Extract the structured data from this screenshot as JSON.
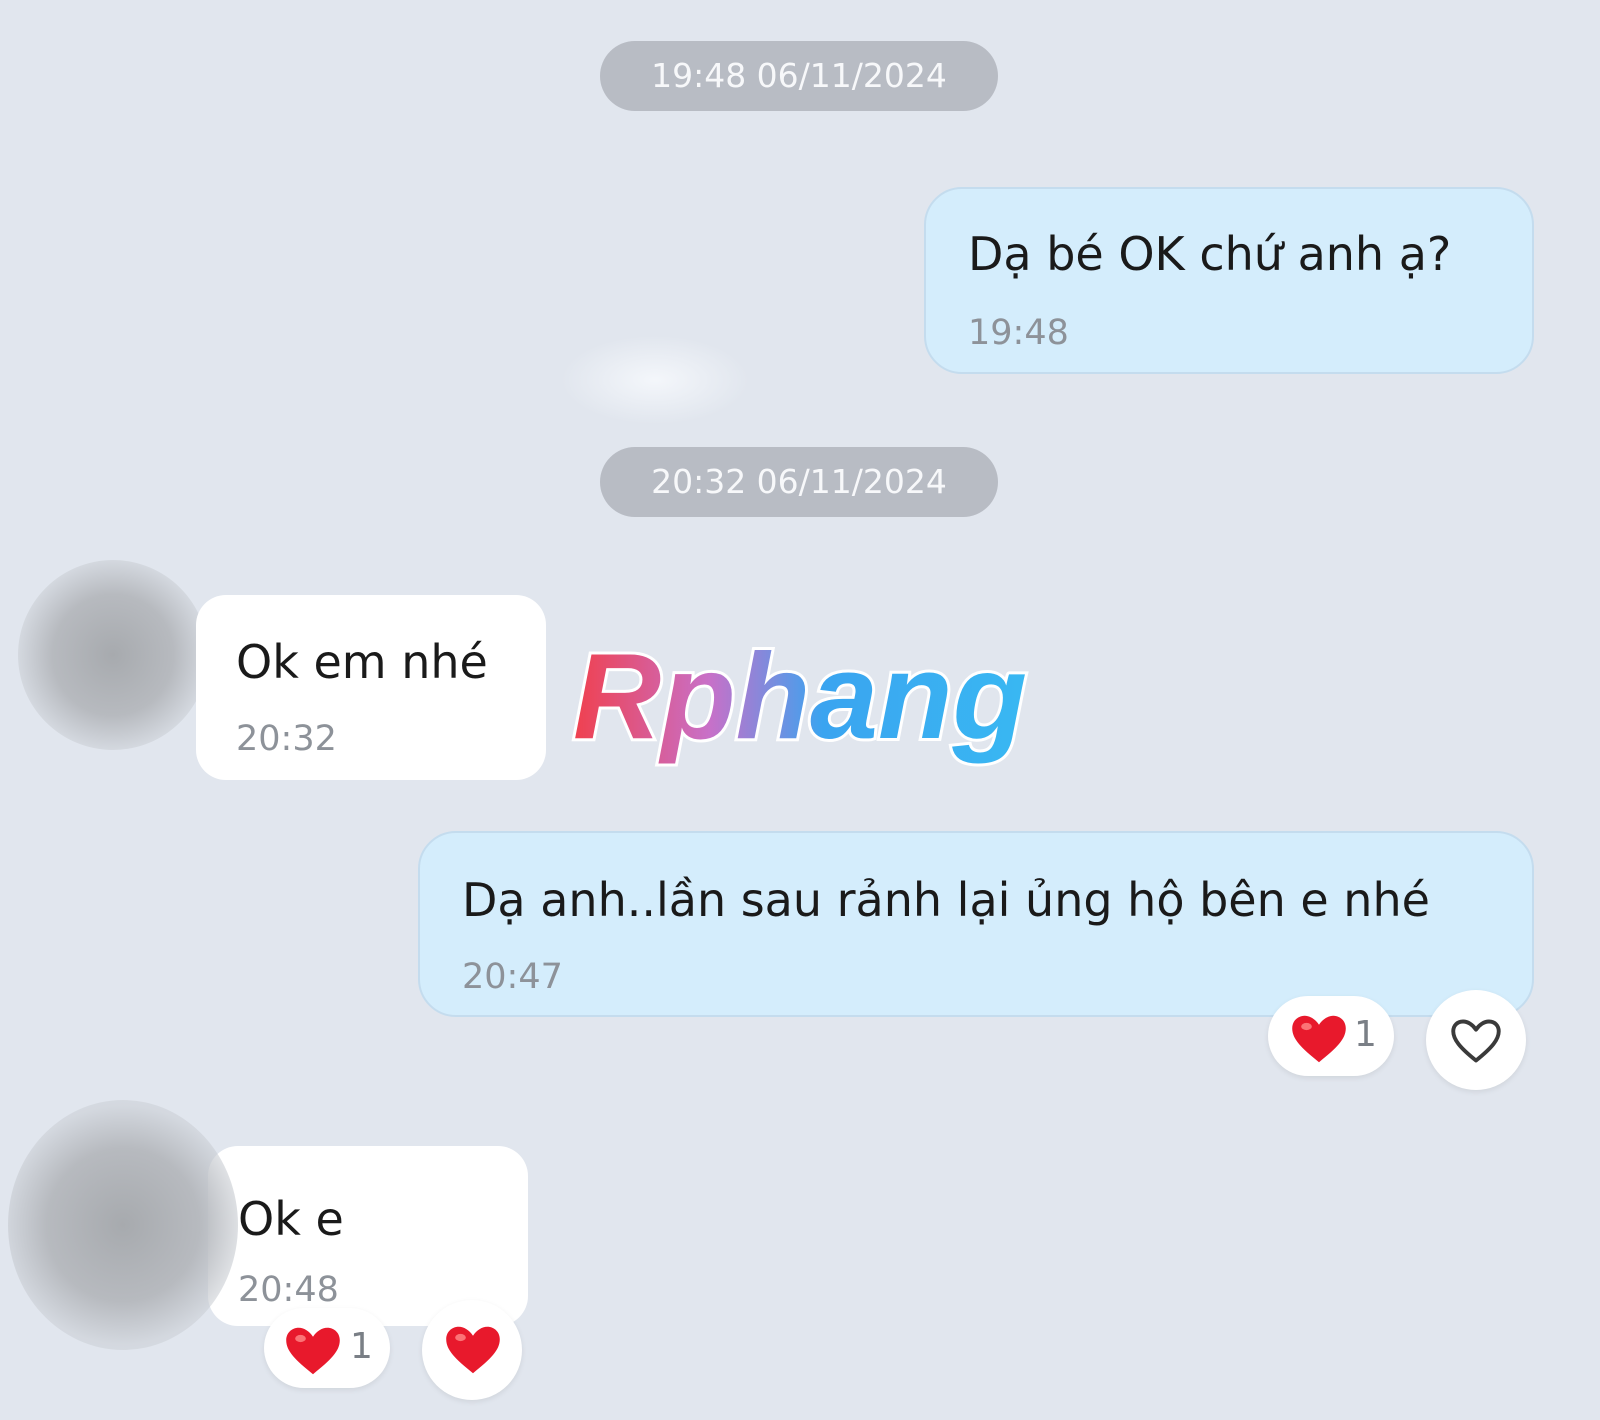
{
  "colors": {
    "background": "#e1e6ee",
    "outgoing_bubble": "#d4edfc",
    "incoming_bubble": "#ffffff",
    "date_pill": "#b8bcc4",
    "heart": "#e8192c",
    "watermark_red": "#f0404e",
    "watermark_blue": "#3aa4f0"
  },
  "dividers": [
    {
      "label": "19:48 06/11/2024"
    },
    {
      "label": "20:32 06/11/2024"
    }
  ],
  "messages": [
    {
      "direction": "outgoing",
      "text": "Dạ bé OK chứ anh ạ?",
      "time": "19:48"
    },
    {
      "direction": "incoming",
      "text": "Ok em nhé",
      "time": "20:32",
      "avatar": "blurred"
    },
    {
      "direction": "outgoing",
      "text": "Dạ anh..lần sau rảnh lại ủng hộ bên e nhé",
      "time": "20:47",
      "reaction": {
        "icon": "red-heart-icon",
        "count": "1"
      },
      "react_button": "heart-outline-icon"
    },
    {
      "direction": "incoming",
      "text": "Ok e",
      "time": "20:48",
      "avatar": "blurred",
      "reaction": {
        "icon": "red-heart-icon",
        "count": "1"
      },
      "react_button": "red-heart-icon"
    }
  ],
  "watermark": {
    "text": "Rphang"
  }
}
